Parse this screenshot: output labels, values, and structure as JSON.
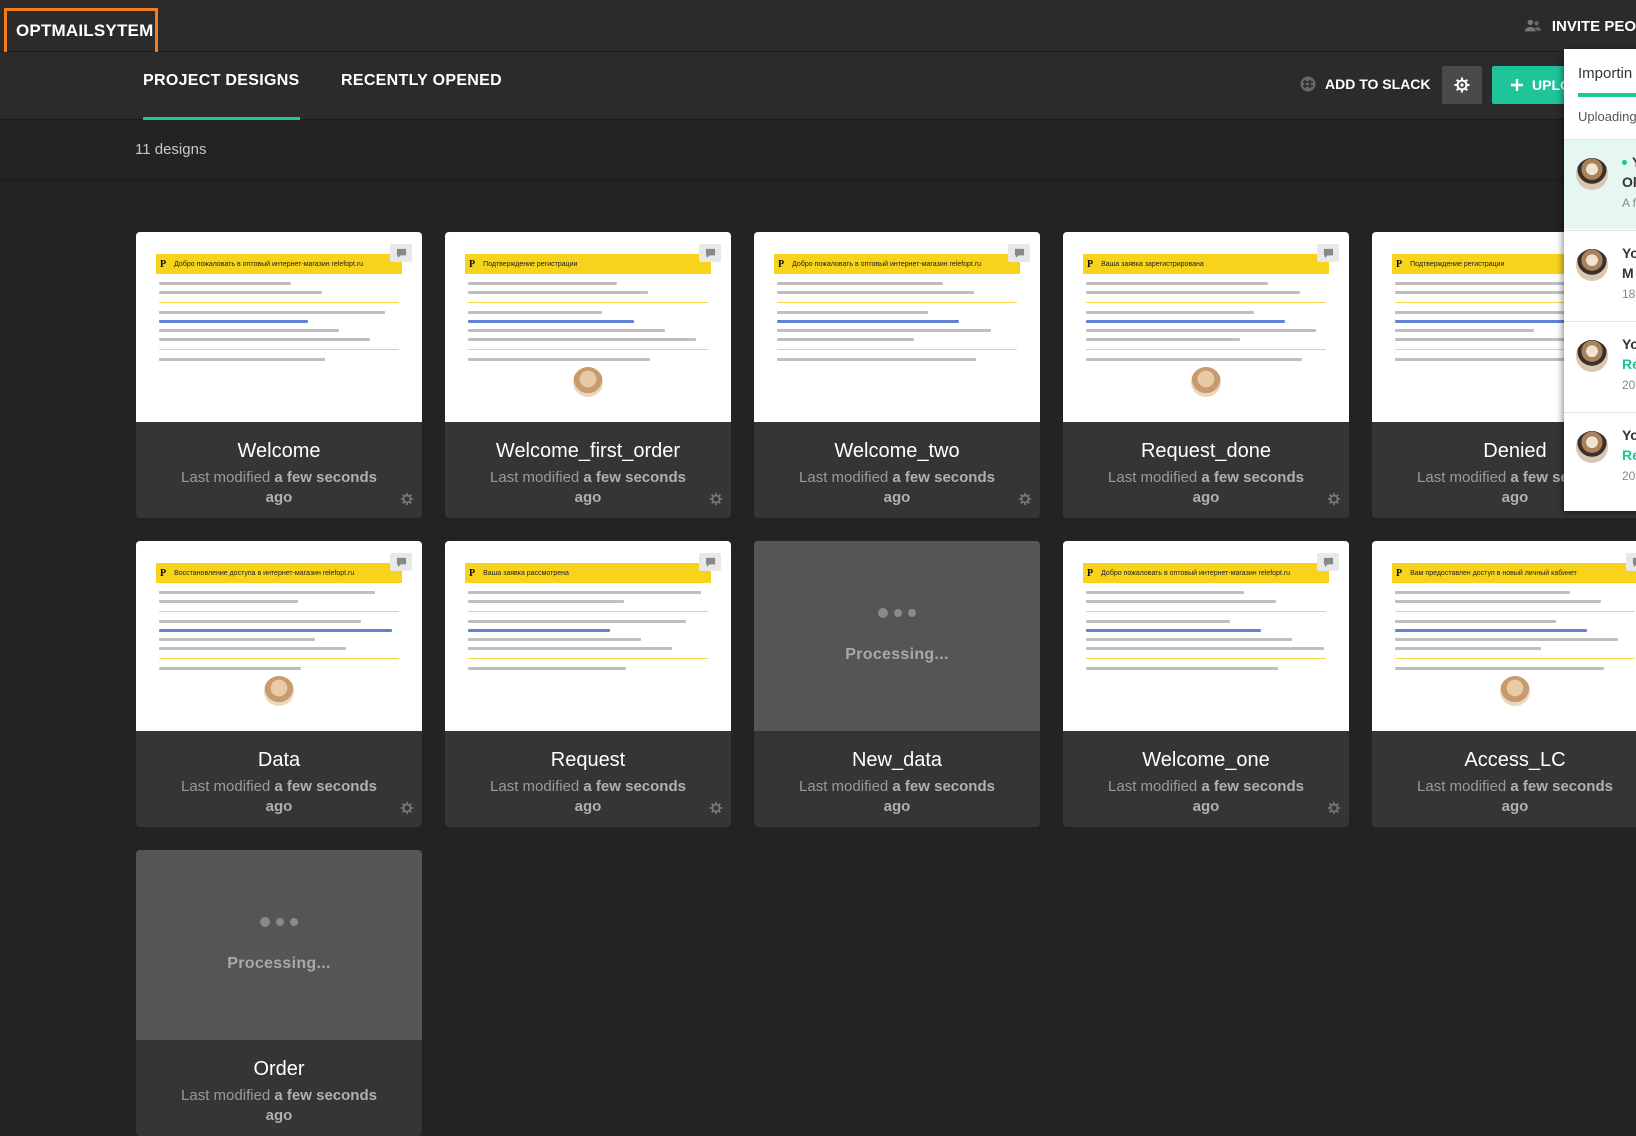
{
  "app": {
    "title": "OPTMAILSYTEM",
    "invite_label": "INVITE PEO"
  },
  "tabs": [
    {
      "label": "PROJECT DESIGNS",
      "active": true
    },
    {
      "label": "RECENTLY OPENED",
      "active": false
    }
  ],
  "toolbar": {
    "add_to_slack": "ADD TO SLACK",
    "upload_label": "UPLO"
  },
  "designs_count": "11 designs",
  "meta": {
    "prefix": "Last modified",
    "time": "a few seconds ago"
  },
  "processing_label": "Processing...",
  "designs": [
    {
      "name": "Welcome",
      "status": "ready",
      "header": "Добро пожаловать в оптовый интернет-магазин relefopt.ru"
    },
    {
      "name": "Welcome_first_order",
      "status": "ready",
      "header": "Подтверждение регистрации"
    },
    {
      "name": "Welcome_two",
      "status": "ready",
      "header": "Добро пожаловать в оптовый интернет-магазин relefopt.ru"
    },
    {
      "name": "Request_done",
      "status": "ready",
      "header": "Ваша заявка зарегистрирована"
    },
    {
      "name": "Denied",
      "status": "ready",
      "header": "Подтверждение регистрации"
    },
    {
      "name": "Data",
      "status": "ready",
      "header": "Восстановление доступа в интернет-магазин relefopt.ru"
    },
    {
      "name": "Request",
      "status": "ready",
      "header": "Ваша заявка рассмотрена"
    },
    {
      "name": "New_data",
      "status": "processing",
      "header": ""
    },
    {
      "name": "Welcome_one",
      "status": "ready",
      "header": "Добро пожаловать в оптовый интернет-магазин relefopt.ru"
    },
    {
      "name": "Access_LC",
      "status": "ready",
      "header": "Вам предоставлен доступ в новый личный кабинет"
    },
    {
      "name": "Order",
      "status": "processing",
      "header": ""
    }
  ],
  "panel": {
    "title": "Importin",
    "subtitle": "Uploading",
    "notifications": [
      {
        "line1": "Y",
        "line2": "Ol",
        "line3": "A f",
        "highlight": true,
        "line2_green": false
      },
      {
        "line1": "Yo",
        "line2": "M",
        "line3": "18",
        "highlight": false,
        "line2_green": false
      },
      {
        "line1": "Yo",
        "line2": "Re",
        "line3": "20",
        "highlight": false,
        "line2_green": true
      },
      {
        "line1": "Yo",
        "line2": "Re",
        "line3": "20",
        "highlight": false,
        "line2_green": true
      }
    ]
  },
  "colors": {
    "accent": "#1fc49a",
    "brand_outline": "#f07d1e",
    "email_header": "#f8d31c",
    "background": "#232323"
  }
}
